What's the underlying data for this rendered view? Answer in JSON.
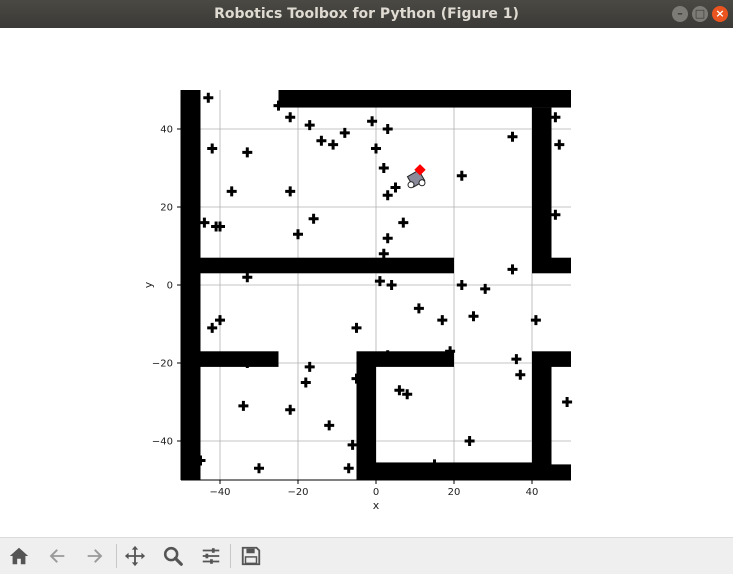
{
  "window": {
    "title": "Robotics Toolbox for Python (Figure 1)",
    "controls": [
      "minimize-icon",
      "maximize-icon",
      "close-icon"
    ]
  },
  "toolbar": {
    "buttons": [
      "home-icon",
      "back-arrow-icon",
      "forward-arrow-icon",
      "pan-icon",
      "zoom-icon",
      "configure-subplots-icon",
      "save-icon"
    ]
  },
  "chart_data": {
    "type": "scatter",
    "xlabel": "x",
    "ylabel": "y",
    "xlim": [
      -50,
      50
    ],
    "ylim": [
      -50,
      50
    ],
    "xticks": [
      -40,
      -20,
      0,
      20,
      40
    ],
    "yticks": [
      -40,
      -20,
      0,
      20,
      40
    ],
    "grid": true,
    "map": "occupancy grid with black walls",
    "landmarks": [
      [
        -43,
        48
      ],
      [
        -25,
        46
      ],
      [
        -22,
        43
      ],
      [
        -17,
        41
      ],
      [
        -14,
        37
      ],
      [
        -11,
        36
      ],
      [
        -8,
        39
      ],
      [
        -1,
        42
      ],
      [
        0,
        35
      ],
      [
        3,
        40
      ],
      [
        35,
        38
      ],
      [
        46,
        43
      ],
      [
        47,
        36
      ],
      [
        -42,
        35
      ],
      [
        -33,
        34
      ],
      [
        -37,
        24
      ],
      [
        -22,
        24
      ],
      [
        2,
        30
      ],
      [
        5,
        25
      ],
      [
        3,
        23
      ],
      [
        22,
        28
      ],
      [
        -44,
        16
      ],
      [
        -41,
        15
      ],
      [
        -40,
        15
      ],
      [
        -16,
        17
      ],
      [
        -20,
        13
      ],
      [
        7,
        16
      ],
      [
        3,
        12
      ],
      [
        46,
        18
      ],
      [
        2,
        8
      ],
      [
        35,
        4
      ],
      [
        -33,
        2
      ],
      [
        1,
        1
      ],
      [
        4,
        0
      ],
      [
        22,
        0
      ],
      [
        28,
        -1
      ],
      [
        11,
        -6
      ],
      [
        17,
        -9
      ],
      [
        25,
        -8
      ],
      [
        -42,
        -11
      ],
      [
        -40,
        -9
      ],
      [
        -5,
        -11
      ],
      [
        41,
        -9
      ],
      [
        3,
        -18
      ],
      [
        19,
        -17
      ],
      [
        36,
        -19
      ],
      [
        -33,
        -20
      ],
      [
        -17,
        -21
      ],
      [
        -18,
        -25
      ],
      [
        37,
        -23
      ],
      [
        -5,
        -24
      ],
      [
        6,
        -27
      ],
      [
        8,
        -28
      ],
      [
        -34,
        -31
      ],
      [
        -22,
        -32
      ],
      [
        49,
        -30
      ],
      [
        -12,
        -36
      ],
      [
        -6,
        -41
      ],
      [
        24,
        -40
      ],
      [
        -45,
        -45
      ],
      [
        -30,
        -47
      ],
      [
        -7,
        -47
      ],
      [
        15,
        -46
      ]
    ],
    "robot": {
      "x": 10,
      "y": 28,
      "marker_color": "#ff0000"
    },
    "colors": {
      "walls": "#000000",
      "landmarks": "#000000",
      "grid": "#b0b0b0"
    }
  }
}
